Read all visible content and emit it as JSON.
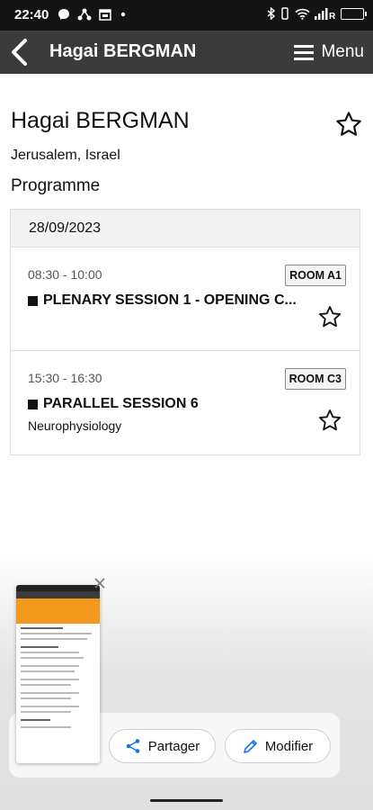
{
  "status_bar": {
    "time": "22:40"
  },
  "app_bar": {
    "title": "Hagai BERGMAN",
    "menu_label": "Menu"
  },
  "person": {
    "name": "Hagai BERGMAN",
    "location": "Jerusalem, Israel"
  },
  "programme": {
    "heading": "Programme",
    "date": "28/09/2023",
    "sessions": [
      {
        "time": "08:30 - 10:00",
        "room": "ROOM A1",
        "title": "PLENARY SESSION 1 - OPENING C...",
        "subtitle": ""
      },
      {
        "time": "15:30 - 16:30",
        "room": "ROOM C3",
        "title": "PARALLEL SESSION 6",
        "subtitle": "Neurophysiology"
      }
    ]
  },
  "share_sheet": {
    "share_label": "Partager",
    "edit_label": "Modifier"
  },
  "colors": {
    "app_bar": "#3b3b3b",
    "status_bar": "#141414",
    "accent": "#1a73e8",
    "thumbnail_header": "#f39a1e"
  }
}
